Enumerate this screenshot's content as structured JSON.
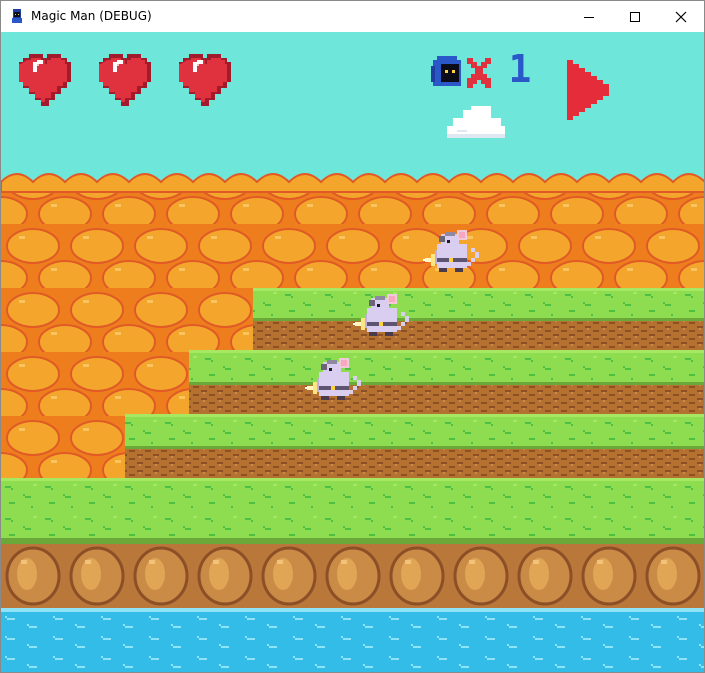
{
  "window": {
    "title": "Magic Man (DEBUG)",
    "app_icon": "wizard-icon",
    "controls": [
      "minimize-icon",
      "maximize-icon",
      "close-icon"
    ]
  },
  "hud": {
    "health_hearts": 3,
    "health_max": 3,
    "lives_icon": "wizard-head-icon",
    "lives_multiplier_icon": "x-icon",
    "lives": 1,
    "play_button_icon": "play-icon",
    "colors": {
      "heart": "#e0313e",
      "heart_dark": "#a01b2c",
      "cross": "#e0313e",
      "lives_digit": "#2b58c8",
      "play": "#e52c3a",
      "wizard_hood": "#2b58c8"
    }
  },
  "scene": {
    "colors": {
      "sky": "#6ee7da",
      "rock_fill": "#f4a52c",
      "rock_shadow": "#ee7d1e",
      "rock_outline": "#e05a26",
      "grass": "#8edc50",
      "grass_light": "#a6e862",
      "grass_mark": "#4fbe44",
      "dirt": "#b5712f",
      "dirt_dark": "#8d4f26",
      "ground": "#c98b46",
      "ground_stone": "#e0a656",
      "water": "#34bce9",
      "water_wave": "#8fe3f6",
      "cloud": "#ffffff",
      "mouse": "#d9cdf0"
    },
    "enemies": [
      {
        "type": "mouse",
        "facing": "left",
        "platform": "top"
      },
      {
        "type": "mouse",
        "facing": "left",
        "platform": "tier-1"
      },
      {
        "type": "mouse",
        "facing": "left",
        "platform": "tier-2"
      }
    ]
  }
}
